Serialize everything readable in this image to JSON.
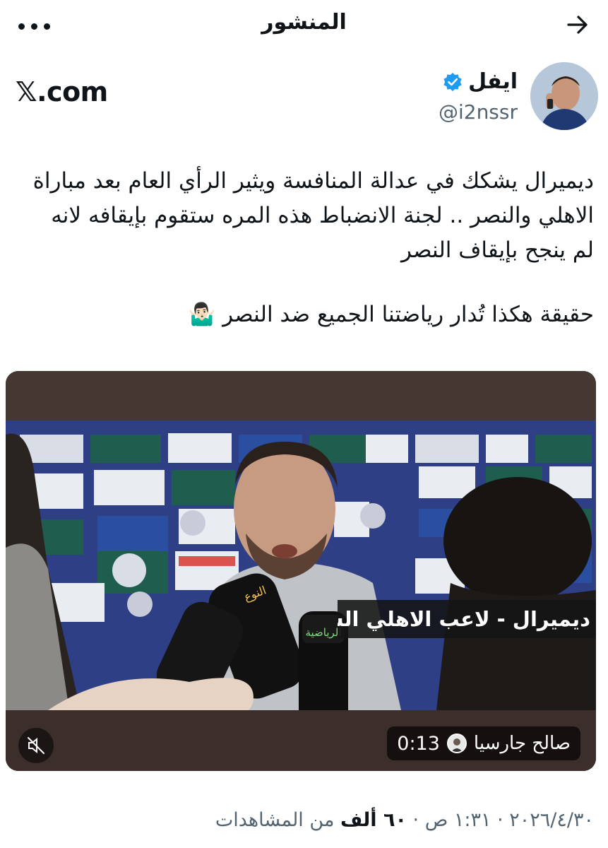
{
  "header": {
    "title": "المنشور"
  },
  "author": {
    "name": "ايفل",
    "handle": "@i2nssr",
    "verified": true
  },
  "watermark": "𝕏.com",
  "tweet": {
    "line1": "ديميرال يشكك في عدالة المنافسة ويثير الرأي العام بعد مباراة",
    "line2": "الاهلي والنصر .. لجنة الانضباط هذه المره ستقوم بإيقافه لانه",
    "line3": "لم ينجح بإيقاف النصر",
    "line4": "حقيقة هكذا تُدار رياضتنا الجميع ضد النصر 🤷🏻‍♂️"
  },
  "media": {
    "caption": "ديميرال - لاعب الاهلي السعودي",
    "duration": "0:13",
    "channel": "صالح جارسيا",
    "mic_label_1": "النوع",
    "mic_label_2": "الرياضية"
  },
  "meta": {
    "time": "١:٣١ ص",
    "date": "٢٠٢٦/٤/٣٠",
    "views_value": "٦٠ ألف",
    "views_label": "من المشاهدات"
  },
  "colors": {
    "verified": "#1d9bf0",
    "muted_text": "#536471",
    "text": "#0f1419"
  },
  "icons": {
    "more": "more-dots-icon",
    "back": "arrow-right-icon",
    "mute": "speaker-muted-icon"
  }
}
